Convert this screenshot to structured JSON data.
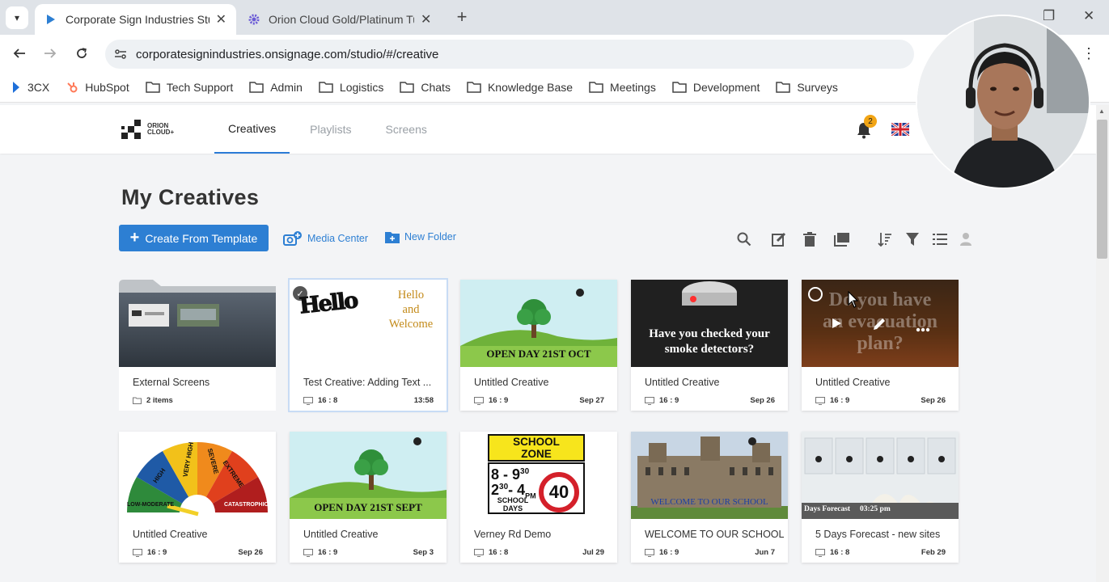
{
  "browser": {
    "tabs": [
      {
        "title": "Corporate Sign Industries Studio",
        "active": true
      },
      {
        "title": "Orion Cloud Gold/Platinum Tutorial",
        "active": false
      }
    ],
    "url": "corporatesignindustries.onsignage.com/studio/#/creative",
    "bookmarks": [
      "3CX",
      "HubSpot",
      "Tech Support",
      "Admin",
      "Logistics",
      "Chats",
      "Knowledge Base",
      "Meetings",
      "Development",
      "Surveys"
    ]
  },
  "app": {
    "logo_line1": "ORION",
    "logo_line2": "CLOUD+",
    "nav": [
      "Creatives",
      "Playlists",
      "Screens"
    ],
    "notifications": "2",
    "accent": "#2d7fd3"
  },
  "main": {
    "title": "My Creatives",
    "create_label": "Create From Template",
    "media_center_label": "Media Center",
    "new_folder_label": "New Folder"
  },
  "folder": {
    "title": "External Screens",
    "meta": "2 items"
  },
  "cards": [
    {
      "title": "Test Creative: Adding Text ...",
      "ratio": "16 : 8",
      "date": "13:58",
      "thumb_text": [
        "Hello",
        "and",
        "Welcome"
      ],
      "thumb_word": "Hello"
    },
    {
      "title": "Untitled Creative",
      "ratio": "16 : 9",
      "date": "Sep 27",
      "thumb_text": [
        "OPEN DAY 21ST OCT"
      ]
    },
    {
      "title": "Untitled Creative",
      "ratio": "16 : 9",
      "date": "Sep 26",
      "thumb_text": [
        "Have you checked your",
        "smoke detectors?"
      ]
    },
    {
      "title": "Untitled Creative",
      "ratio": "16 : 9",
      "date": "Sep 26",
      "thumb_text": [
        "Do you have",
        "an evacuation",
        "plan?"
      ]
    },
    {
      "title": "Untitled Creative",
      "ratio": "16 : 9",
      "date": "Sep 26",
      "thumb_text": [
        "LOW-MODERATE",
        "HIGH",
        "VERY HIGH",
        "SEVERE",
        "EXTREME",
        "CATASTROPHIC"
      ]
    },
    {
      "title": "Untitled Creative",
      "ratio": "16 : 9",
      "date": "Sep 3",
      "thumb_text": [
        "OPEN DAY 21ST SEPT"
      ]
    },
    {
      "title": "Verney Rd Demo",
      "ratio": "16 : 8",
      "date": "Jul 29",
      "thumb_text": [
        "SCHOOL",
        "ZONE",
        "8 - 9",
        "30",
        "2",
        "30",
        "- 4",
        "PM",
        "SCHOOL",
        "DAYS",
        "40"
      ]
    },
    {
      "title": "WELCOME TO OUR SCHOOL",
      "ratio": "16 : 9",
      "date": "Jun 7",
      "thumb_text": [
        "WELCOME TO OUR SCHOOL"
      ]
    },
    {
      "title": "5 Days Forecast - new sites",
      "ratio": "16 : 8",
      "date": "Feb 29",
      "thumb_text": [
        "Days Forecast",
        "03:25 pm"
      ]
    }
  ]
}
